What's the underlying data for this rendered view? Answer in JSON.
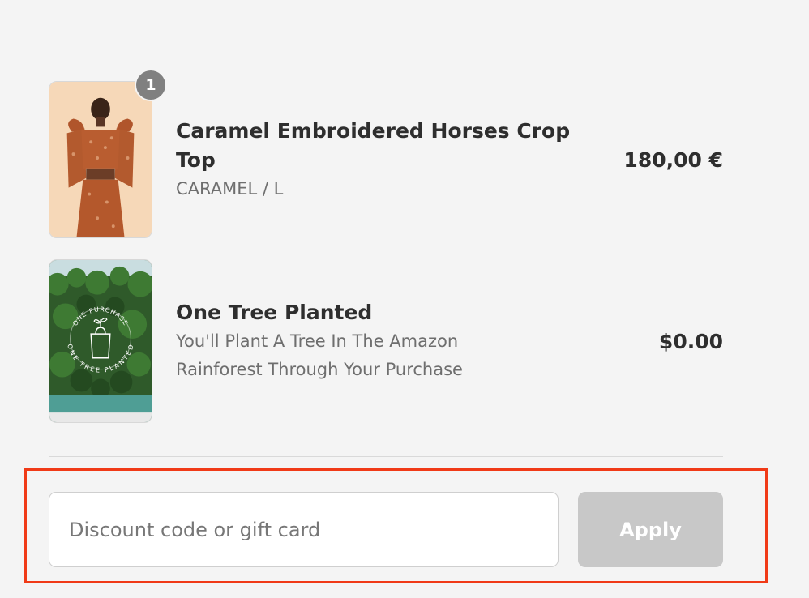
{
  "cart": {
    "items": [
      {
        "title": "Caramel Embroidered Horses Crop Top",
        "variant": "CARAMEL / L",
        "price": "180,00 €",
        "quantity": "1",
        "image": "caramel-dress-product-photo"
      },
      {
        "title": "One Tree Planted",
        "description": "You'll Plant A Tree In The Amazon Rainforest Through Your Purchase",
        "price": "$0.00",
        "image": "rainforest-one-tree-planted-photo",
        "image_text": {
          "top_arc": "ONE PURCHASE",
          "bottom_arc": "ONE TREE PLANTED"
        }
      }
    ]
  },
  "discount": {
    "placeholder": "Discount code or gift card",
    "value": "",
    "apply_label": "Apply"
  },
  "colors": {
    "background": "#f4f4f4",
    "highlight_border": "#f03a17",
    "apply_button_disabled": "#c8c8c8",
    "badge": "#808080"
  }
}
